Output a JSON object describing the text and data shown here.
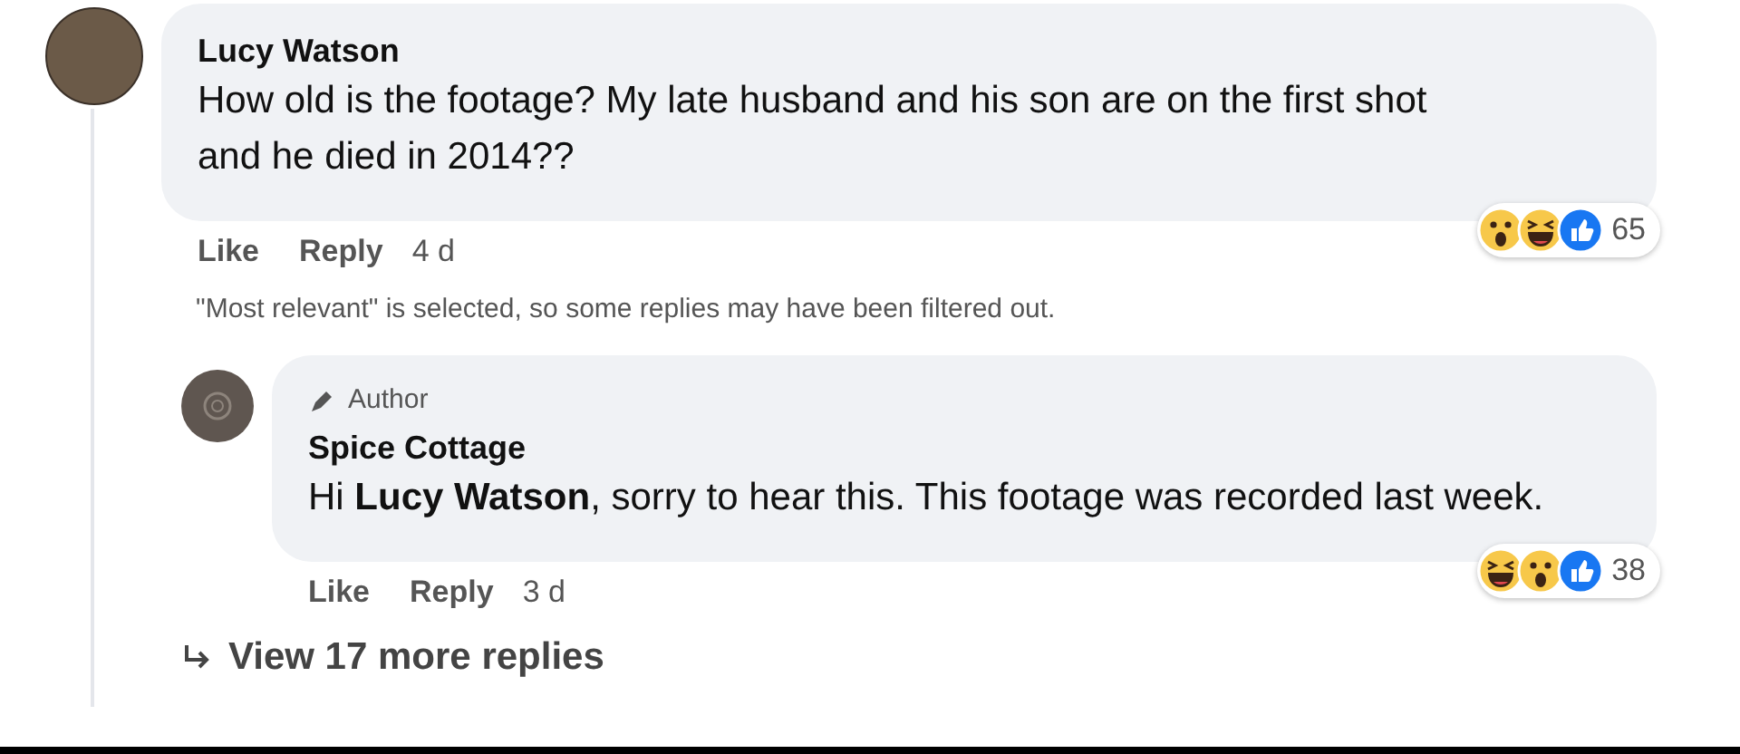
{
  "comments": [
    {
      "author": "Lucy Watson",
      "text": "How old is the footage? My late husband and his son are on the first shot and he died in 2014??",
      "reactions": [
        {
          "kind": "wow"
        },
        {
          "kind": "haha"
        },
        {
          "kind": "like"
        }
      ],
      "reaction_count": "65",
      "actions": [
        "Like",
        "Reply"
      ],
      "time": "4 d"
    }
  ],
  "filter_note": "\"Most relevant\" is selected, so some replies may have been filtered out.",
  "replies": [
    {
      "author": "Spice Cottage",
      "badge": "Author",
      "text": "Hi **Lucy Watson**, sorry to hear this. This footage was recorded last week.",
      "reactions": [
        {
          "kind": "haha"
        },
        {
          "kind": "wow"
        },
        {
          "kind": "like"
        }
      ],
      "reaction_count": "38",
      "actions": [
        "Like",
        "Reply"
      ],
      "time": "3 d"
    }
  ],
  "more_replies": "View 17 more replies"
}
